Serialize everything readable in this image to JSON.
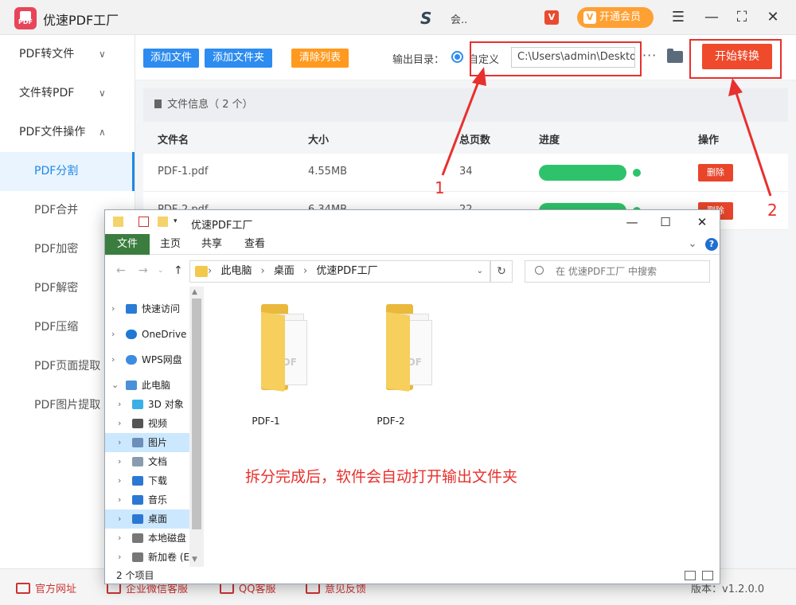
{
  "titlebar": {
    "app_name": "优速PDF工厂",
    "app_logo_text": "PDF",
    "user_name": "会..",
    "vip_label": "开通会员",
    "vip_icon_text": "V"
  },
  "sidebar": {
    "groups": [
      {
        "label": "PDF转文件"
      },
      {
        "label": "文件转PDF"
      },
      {
        "label": "PDF文件操作"
      }
    ],
    "items": [
      {
        "label": "PDF分割",
        "active": true
      },
      {
        "label": "PDF合并"
      },
      {
        "label": "PDF加密"
      },
      {
        "label": "PDF解密"
      },
      {
        "label": "PDF压缩"
      },
      {
        "label": "PDF页面提取"
      },
      {
        "label": "PDF图片提取"
      }
    ]
  },
  "toolbar": {
    "add_file": "添加文件",
    "add_folder": "添加文件夹",
    "clear_list": "清除列表",
    "output_label": "输出目录：",
    "custom_label": "自定义",
    "output_path": "C:\\Users\\admin\\Desktop",
    "more": "···",
    "start": "开始转换"
  },
  "file_info": {
    "title": "文件信息（ 2 个）"
  },
  "table": {
    "headers": [
      "文件名",
      "大小",
      "总页数",
      "进度",
      "操作"
    ],
    "rows": [
      {
        "name": "PDF-1.pdf",
        "size": "4.55MB",
        "pages": "34",
        "progress": 1.0,
        "action": "删除"
      },
      {
        "name": "PDF-2.pdf",
        "size": "6.34MB",
        "pages": "22",
        "progress": 1.0,
        "action": "删除"
      }
    ]
  },
  "callouts": {
    "one": "1",
    "two": "2"
  },
  "statusbar": {
    "website": "官方网址",
    "wechat": "企业微信客服",
    "qq": "QQ客服",
    "feedback": "意见反馈",
    "version": "版本：v1.2.0.0"
  },
  "explorer": {
    "title": "优速PDF工厂",
    "ribbon_tabs": [
      "文件",
      "主页",
      "共享",
      "查看"
    ],
    "breadcrumb": [
      "此电脑",
      "桌面",
      "优速PDF工厂"
    ],
    "search_placeholder": "在 优速PDF工厂 中搜索",
    "nav": [
      {
        "label": "快速访问",
        "icon": "star-icon",
        "color": "#2a7bd6",
        "chev": "›"
      },
      {
        "label": "OneDrive",
        "icon": "cloud-icon",
        "color": "#1e78d4",
        "chev": "›"
      },
      {
        "label": "WPS网盘",
        "icon": "cloud-icon",
        "color": "#3b8de0",
        "chev": "›"
      },
      {
        "label": "此电脑",
        "icon": "computer-icon",
        "color": "#4a90d9",
        "chev": "⌄"
      },
      {
        "label": "3D 对象",
        "icon": "cube-icon",
        "color": "#3ab0e6",
        "chev": "›"
      },
      {
        "label": "视频",
        "icon": "film-icon",
        "color": "#555555",
        "chev": "›"
      },
      {
        "label": "图片",
        "icon": "picture-icon",
        "color": "#6b8fb8",
        "chev": "›",
        "selected": true
      },
      {
        "label": "文档",
        "icon": "document-icon",
        "color": "#8a9bb0",
        "chev": "›"
      },
      {
        "label": "下载",
        "icon": "download-icon",
        "color": "#2b78d4",
        "chev": "›"
      },
      {
        "label": "音乐",
        "icon": "music-icon",
        "color": "#2b78d4",
        "chev": "›"
      },
      {
        "label": "桌面",
        "icon": "desktop-icon",
        "color": "#2b78d4",
        "chev": "›",
        "selected": true
      },
      {
        "label": "本地磁盘",
        "icon": "drive-icon",
        "color": "#777777",
        "chev": "›"
      },
      {
        "label": "新加卷 (E:",
        "icon": "drive-icon",
        "color": "#777777",
        "chev": "›"
      }
    ],
    "folders": [
      {
        "label": "PDF-1",
        "pdf_text": "PDF"
      },
      {
        "label": "PDF-2",
        "pdf_text": "PDF"
      }
    ],
    "note": "拆分完成后，软件会自动打开输出文件夹",
    "item_count": "2 个项目"
  },
  "colors": {
    "accent_blue": "#2d8cf0",
    "accent_orange": "#ff9a1f",
    "danger_red": "#ee4a2b",
    "progress_green": "#2ec36b",
    "annotation_red": "#e8302e"
  }
}
